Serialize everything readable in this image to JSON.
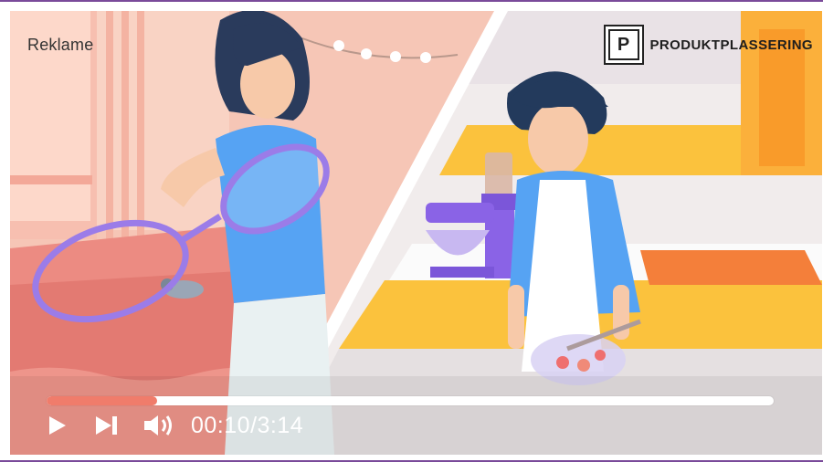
{
  "labels": {
    "ad": "Reklame",
    "product_placement_letter": "P",
    "product_placement": "PRODUKTPLASSERING"
  },
  "player": {
    "current_time": "00:10",
    "separator": "/",
    "duration": "3:14",
    "progress_fraction": 0.152
  },
  "icons": {
    "play": "play-icon",
    "next": "skip-next-icon",
    "volume": "volume-icon"
  },
  "colors": {
    "progress_fill": "#f07c6b",
    "progress_track": "#ffffff",
    "left_scene_bg": "#f6c6b6",
    "right_scene_bg": "#f1ecec",
    "magnifier": "#9b7ce8",
    "border_accent": "#7a4a9a"
  }
}
